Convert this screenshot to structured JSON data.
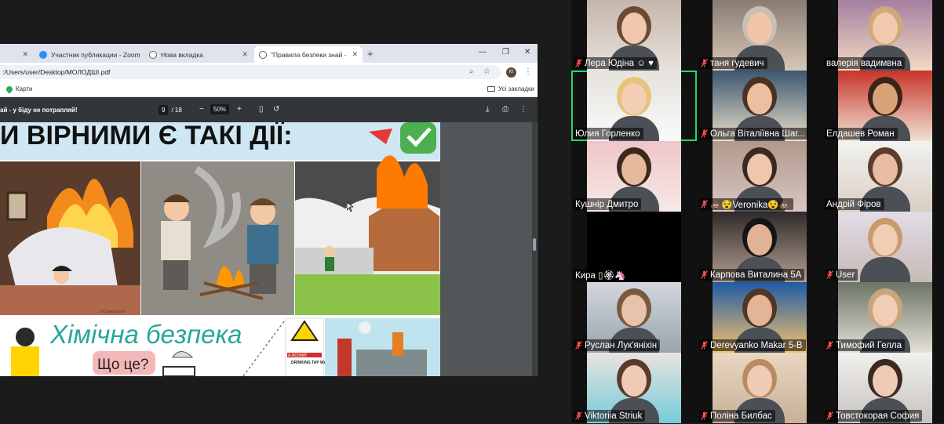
{
  "browser": {
    "tabs": [
      {
        "label": "",
        "active": false
      },
      {
        "label": "Участник публикации - Zoom",
        "active": false
      },
      {
        "label": "Нова вкладка",
        "active": false
      },
      {
        "label": "\"Правила безпеки знай - у біду",
        "active": true
      }
    ],
    "new_tab": "+",
    "url": ":/Users/user/Desktop/МОЛОДШІ.pdf",
    "avatar_initials": "КІ",
    "bookmarks": {
      "left": "Карти",
      "right": "Усі закладки"
    },
    "pdf": {
      "title": "ай - у біду не потрапляй!",
      "page_current": "9",
      "page_total": "/ 18",
      "zoom": "50%",
      "page_content": {
        "heading_fragment": "И ВІРНИМИ Є ТАКІ ДІЇ:",
        "chem_heading": "Хімічна безпека",
        "chem_question": "Що це?",
        "poster_text": "DRINKING TAP WATER",
        "poster_banner": "А ЯСНИЙ!",
        "credit": "©Сollecidcord"
      }
    }
  },
  "zoom": {
    "accent_active": "#23d96f",
    "participants": [
      {
        "name": "Лера Юдіна ☺ ♥",
        "muted": true
      },
      {
        "name": "таня гудевич",
        "muted": true
      },
      {
        "name": "валерія вадимвна",
        "muted": false
      },
      {
        "name": "Юлия Горленко",
        "muted": false,
        "speaking": true
      },
      {
        "name": "Ольга Віталіївна Шаг...",
        "muted": true
      },
      {
        "name": "Елдашев Роман",
        "muted": false
      },
      {
        "name": "Кушнір Дмитро",
        "muted": false
      },
      {
        "name": "💩😵Veronika😵💩",
        "muted": true
      },
      {
        "name": "Андрій Фіров",
        "muted": false
      },
      {
        "name": "Кира ▯🏵🦄",
        "muted": false
      },
      {
        "name": "Карпова Виталина 5А",
        "muted": true
      },
      {
        "name": "User",
        "muted": true
      },
      {
        "name": "Руслан Лук'яніхін",
        "muted": true
      },
      {
        "name": "Derevyanko Makar 5-B",
        "muted": true
      },
      {
        "name": "Тимофий Гелла",
        "muted": true
      },
      {
        "name": "Viktoriia Striuk",
        "muted": true
      },
      {
        "name": "Поліна Билбас",
        "muted": true
      },
      {
        "name": "Товстокорая София",
        "muted": true
      }
    ]
  }
}
